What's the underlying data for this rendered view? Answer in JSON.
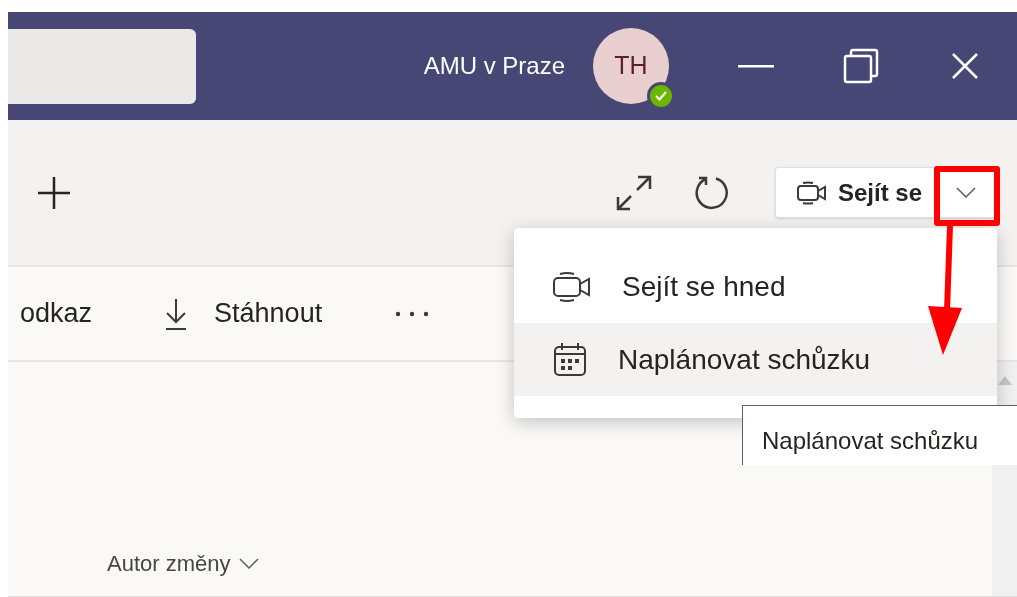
{
  "title_bar": {
    "org_name": "AMU v Praze",
    "avatar": {
      "initials": "TH",
      "online": true
    }
  },
  "header": {
    "meet_button": {
      "label": "Sejít se"
    }
  },
  "toolbar": {
    "items": [
      {
        "kind": "text",
        "label": "odkaz"
      },
      {
        "kind": "download",
        "label": "Stáhnout"
      },
      {
        "kind": "more"
      }
    ]
  },
  "column_header": {
    "label": "Autor změny"
  },
  "meet_menu": {
    "items": [
      {
        "kind": "video",
        "label": "Sejít se hned",
        "selected": false
      },
      {
        "kind": "calendar",
        "label": "Naplánovat schůzku",
        "selected": true
      }
    ]
  },
  "tooltip": {
    "text": "Naplánovat schůzku"
  },
  "annotations": {
    "highlight_box": true,
    "arrow": true
  }
}
